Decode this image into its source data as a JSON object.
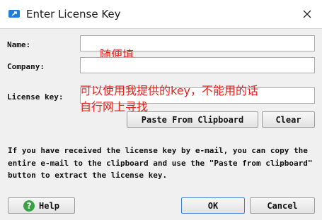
{
  "window": {
    "title": "Enter License Key",
    "icons": {
      "app": "app-icon",
      "close": "close-icon"
    }
  },
  "form": {
    "name_label": "Name:",
    "company_label": "Company:",
    "license_label": "License key:",
    "name_value": "",
    "company_value": "",
    "license_value": ""
  },
  "annotations": {
    "name_note": "随便填",
    "license_note_line1": "可以使用我提供的key，不能用的话",
    "license_note_line2": "自行网上寻找",
    "color": "#e8211a"
  },
  "buttons": {
    "paste": "Paste From Clipboard",
    "clear": "Clear",
    "help": "Help",
    "ok": "OK",
    "cancel": "Cancel"
  },
  "info_text": "If you have received the license key by e-mail, you can copy the entire e-mail to the clipboard and use the \"Paste from clipboard\" button to extract the license key.",
  "colors": {
    "accent": "#1e7ed8",
    "help_icon": "#3aa143",
    "ok_border": "#3c7fd2"
  }
}
